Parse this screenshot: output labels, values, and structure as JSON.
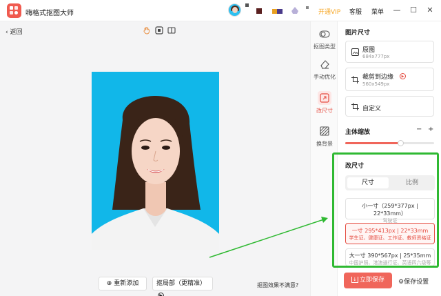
{
  "app": {
    "title": "嗨格式抠图大师"
  },
  "header": {
    "vip": "开通VIP",
    "service": "客服",
    "menu": "菜单",
    "minimize": "—",
    "maximize": "☐",
    "close": "✕"
  },
  "canvas": {
    "back": "返回",
    "readd": "重新添加",
    "cut_part": "抠局部（更精准）",
    "dissatisfied": "抠图效果不满意?"
  },
  "toolcol": {
    "items": [
      {
        "label": "抠图类型"
      },
      {
        "label": "手动优化"
      },
      {
        "label": "改尺寸"
      },
      {
        "label": "换背景"
      }
    ]
  },
  "panel": {
    "image_size_title": "图片尺寸",
    "original": {
      "label": "原图",
      "sub": "684x777px"
    },
    "crop": {
      "label": "裁剪到边缘",
      "sub": "560x549px"
    },
    "custom": {
      "label": "自定义"
    },
    "subject_zoom": {
      "label": "主体缩放",
      "minus": "−",
      "plus": "+",
      "value": 0.62
    },
    "resize_title": "改尺寸",
    "tabs": {
      "size": "尺寸",
      "ratio": "比例"
    },
    "sizes": [
      {
        "label": "小一寸（259*377px | 22*33mm）",
        "sub": "驾驶证"
      },
      {
        "label": "一寸 295*413px | 22*33mm",
        "sub": "学生证、健康证、工作证、教师资格证"
      },
      {
        "label": "大一寸 390*567px | 25*35mm",
        "sub": "中国护照、港澳通行证、英语四六级等"
      }
    ],
    "save": "立即保存",
    "save_settings": "保存设置"
  },
  "colors": {
    "accent": "#f0665b",
    "highlight": "#2fb932",
    "photo_bg": "#11b7e9",
    "vip": "#f6a623"
  }
}
